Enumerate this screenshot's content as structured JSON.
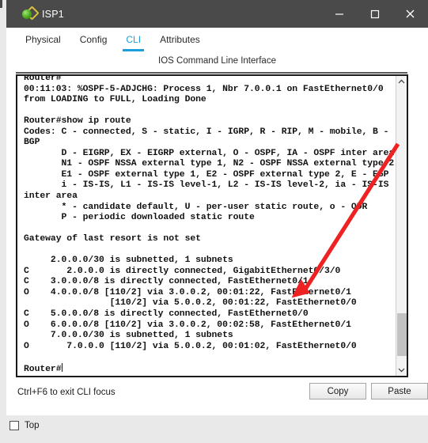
{
  "window": {
    "title": "ISP1",
    "icon": "packet-tracer-icon",
    "controls": {
      "minimize": "minimize-icon",
      "maximize": "maximize-icon",
      "close": "close-icon"
    }
  },
  "tabs": [
    {
      "label": "Physical",
      "active": false
    },
    {
      "label": "Config",
      "active": false
    },
    {
      "label": "CLI",
      "active": true
    },
    {
      "label": "Attributes",
      "active": false
    }
  ],
  "cli": {
    "header": "IOS Command Line Interface",
    "lines": [
      "Router#",
      "00:11:03: %OSPF-5-ADJCHG: Process 1, Nbr 7.0.0.1 on FastEthernet0/0",
      "from LOADING to FULL, Loading Done",
      "",
      "Router#show ip route",
      "Codes: C - connected, S - static, I - IGRP, R - RIP, M - mobile, B -",
      "BGP",
      "       D - EIGRP, EX - EIGRP external, O - OSPF, IA - OSPF inter area",
      "       N1 - OSPF NSSA external type 1, N2 - OSPF NSSA external type 2",
      "       E1 - OSPF external type 1, E2 - OSPF external type 2, E - EGP",
      "       i - IS-IS, L1 - IS-IS level-1, L2 - IS-IS level-2, ia - IS-IS",
      "inter area",
      "       * - candidate default, U - per-user static route, o - ODR",
      "       P - periodic downloaded static route",
      "",
      "Gateway of last resort is not set",
      "",
      "     2.0.0.0/30 is subnetted, 1 subnets",
      "C       2.0.0.0 is directly connected, GigabitEthernet0/3/0",
      "C    3.0.0.0/8 is directly connected, FastEthernet0/1",
      "O    4.0.0.0/8 [110/2] via 3.0.0.2, 00:01:22, FastEthernet0/1",
      "                [110/2] via 5.0.0.2, 00:01:22, FastEthernet0/0",
      "C    5.0.0.0/8 is directly connected, FastEthernet0/0",
      "O    6.0.0.0/8 [110/2] via 3.0.0.2, 00:02:58, FastEthernet0/1",
      "     7.0.0.0/30 is subnetted, 1 subnets",
      "O       7.0.0.0 [110/2] via 5.0.0.2, 00:01:02, FastEthernet0/0",
      "",
      "Router#"
    ],
    "scrollbar": {
      "up": "chevron-up-icon",
      "down": "chevron-down-icon"
    }
  },
  "footer": {
    "focus_hint": "Ctrl+F6 to exit CLI focus",
    "copy_label": "Copy",
    "paste_label": "Paste"
  },
  "bottom": {
    "top_checkbox_label": "Top",
    "top_checked": false
  },
  "annotation": {
    "type": "arrow",
    "color": "#ee2222",
    "points_at": "FastEthernet0/1"
  }
}
